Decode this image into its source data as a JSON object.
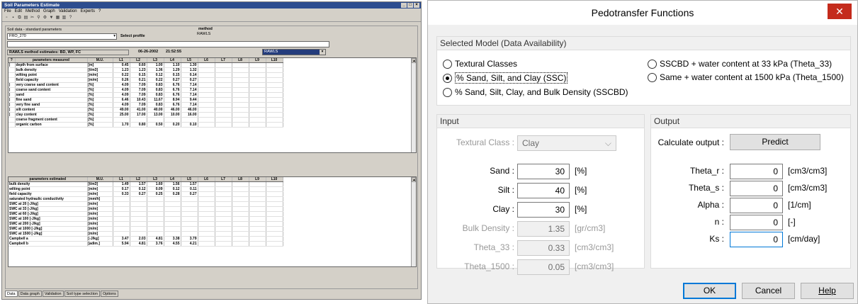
{
  "left": {
    "title": "Soil Parameters Estimate",
    "menu": [
      "File",
      "Edit",
      "Method",
      "Graph",
      "Validation",
      "Experts",
      "?"
    ],
    "subtitle": "Soil data - standard parameters",
    "profile": "FRO_270",
    "select_profile": "Select profile",
    "method_label": "method",
    "method_value": "RAWLS",
    "estimates_label": "RAWLS method estimates: BD, WP, FC",
    "date": "06-26-2002",
    "time": "21:52:55",
    "method_combo": "RAWLS",
    "measured_headers": [
      "?",
      "parameters measured",
      "M.U.",
      "L1",
      "L2",
      "L3",
      "L4",
      "L5",
      "L6",
      "L7",
      "L8",
      "L9",
      "L10"
    ],
    "measured_rows": [
      [
        "|",
        "depth from surface",
        "[m]",
        "0.45",
        "0.60",
        "1.00",
        "1.10",
        "1.30"
      ],
      [
        "",
        "bulk density",
        "[t/m3]",
        "1.23",
        "1.23",
        "1.36",
        "1.29",
        "1.32"
      ],
      [
        "",
        "wilting point",
        "[m/m]",
        "0.22",
        "0.15",
        "0.12",
        "0.15",
        "0.14"
      ],
      [
        "",
        "field capacity",
        "[m/m]",
        "0.26",
        "0.21",
        "0.22",
        "0.27",
        "0.27"
      ],
      [
        "|",
        "very coarse sand content",
        "[%]",
        "4.09",
        "7.09",
        "0.83",
        "6.76",
        "7.14"
      ],
      [
        "|",
        "coarse sand content",
        "[%]",
        "4.09",
        "7.09",
        "0.83",
        "6.76",
        "7.14"
      ],
      [
        "|",
        "sand",
        "[%]",
        "4.09",
        "7.09",
        "0.83",
        "6.76",
        "7.14"
      ],
      [
        "|",
        "fine sand",
        "[%]",
        "6.46",
        "10.43",
        "11.67",
        "8.94",
        "9.44"
      ],
      [
        "|",
        "very fine sand",
        "[%]",
        "4.09",
        "7.09",
        "0.83",
        "6.76",
        "7.14"
      ],
      [
        "|",
        "silt content",
        "[%]",
        "49.00",
        "41.00",
        "40.00",
        "46.00",
        "46.00"
      ],
      [
        "|",
        "clay content",
        "[%]",
        "25.00",
        "17.00",
        "13.00",
        "10.00",
        "16.00"
      ],
      [
        "",
        "coarse fragment content",
        "[%]",
        "",
        "",
        "",
        "",
        ""
      ],
      [
        "",
        "organic carbon",
        "[%]",
        "1.70",
        "0.80",
        "0.50",
        "0.20",
        "0.10"
      ]
    ],
    "estimated_headers": [
      "parameters estimated",
      "M.U.",
      "L1",
      "L2",
      "L3",
      "L4",
      "L5",
      "L6",
      "L7",
      "L8",
      "L9",
      "L10"
    ],
    "estimated_rows": [
      [
        "bulk density",
        "[t/m3]",
        "1.49",
        "1.57",
        "1.60",
        "1.56",
        "1.57"
      ],
      [
        "wilting point",
        "[m/m]",
        "0.17",
        "0.12",
        "0.09",
        "0.12",
        "0.11"
      ],
      [
        "field capacity",
        "[m/m]",
        "0.33",
        "0.27",
        "0.25",
        "0.28",
        "0.27"
      ],
      [
        "saturated hydraulic conductivity",
        "[mm/h]",
        "",
        "",
        "",
        "",
        ""
      ],
      [
        "SWC at 20 [-J/kg]",
        "[m/m]",
        "",
        "",
        "",
        "",
        ""
      ],
      [
        "SWC at 33 [-J/kg]",
        "[m/m]",
        "",
        "",
        "",
        "",
        ""
      ],
      [
        "SWC at 60 [-J/kg]",
        "[m/m]",
        "",
        "",
        "",
        "",
        ""
      ],
      [
        "SWC at 100 [-J/kg]",
        "[m/m]",
        "",
        "",
        "",
        "",
        ""
      ],
      [
        "SWC at 200 [-J/kg]",
        "[m/m]",
        "",
        "",
        "",
        "",
        ""
      ],
      [
        "SWC at 1000 [-J/kg]",
        "[m/m]",
        "",
        "",
        "",
        "",
        ""
      ],
      [
        "SWC at 1500 [-J/kg]",
        "[m/m]",
        "",
        "",
        "",
        "",
        ""
      ],
      [
        "Campbell a",
        "[-J/kg]",
        "3.47",
        "2.03",
        "4.81",
        "3.38",
        "3.79"
      ],
      [
        "Campbell b",
        "[adim.]",
        "5.94",
        "4.81",
        "3.76",
        "4.55",
        "4.21"
      ]
    ],
    "tabs": [
      "Data",
      "Data graph",
      "Validation",
      "Soil type selection",
      "Options"
    ]
  },
  "dialog": {
    "title": "Pedotransfer Functions",
    "close": "✕",
    "model_group": "Selected Model (Data Availability)",
    "radios": [
      "Textural Classes",
      "% Sand, Silt, and Clay (SSC)",
      "% Sand, Silt, Clay, and Bulk Density (SSCBD)",
      "SSCBD + water content at 33 kPa (Theta_33)",
      "Same + water content at 1500 kPa (Theta_1500)"
    ],
    "input_group": "Input",
    "output_group": "Output",
    "textural_label": "Textural Class :",
    "textural_value": "Clay",
    "inputs": [
      {
        "label": "Sand :",
        "value": "30",
        "unit": "[%]"
      },
      {
        "label": "Silt :",
        "value": "40",
        "unit": "[%]"
      },
      {
        "label": "Clay :",
        "value": "30",
        "unit": "[%]"
      },
      {
        "label": "Bulk Density :",
        "value": "1.35",
        "unit": "[gr/cm3]"
      },
      {
        "label": "Theta_33 :",
        "value": "0.33",
        "unit": "[cm3/cm3]"
      },
      {
        "label": "Theta_1500 :",
        "value": "0.05",
        "unit": "[cm3/cm3]"
      }
    ],
    "calc_label": "Calculate output :",
    "predict": "Predict",
    "outputs": [
      {
        "label": "Theta_r :",
        "value": "0",
        "unit": "[cm3/cm3]"
      },
      {
        "label": "Theta_s :",
        "value": "0",
        "unit": "[cm3/cm3]"
      },
      {
        "label": "Alpha :",
        "value": "0",
        "unit": "[1/cm]"
      },
      {
        "label": "n :",
        "value": "0",
        "unit": "[-]"
      },
      {
        "label": "Ks :",
        "value": "0",
        "unit": "[cm/day]"
      }
    ],
    "ok": "OK",
    "cancel": "Cancel",
    "help": "Help"
  }
}
